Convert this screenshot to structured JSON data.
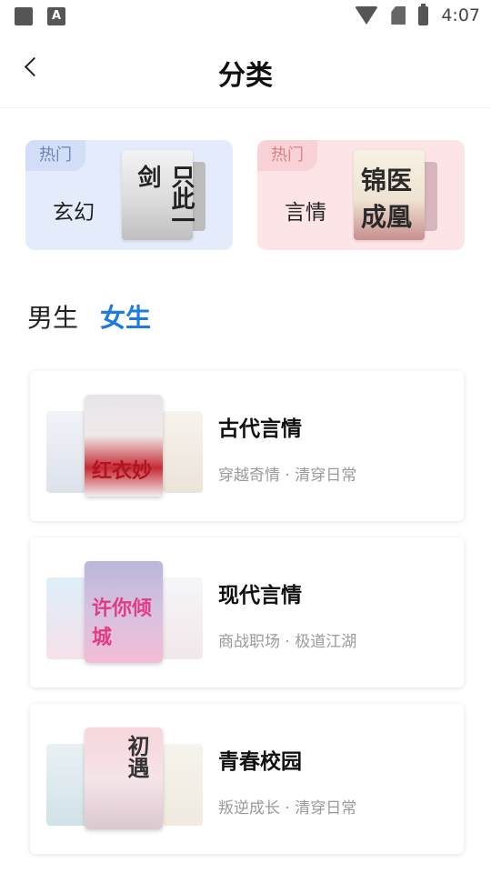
{
  "status_bar": {
    "time": "4:07",
    "icons": [
      "image-icon",
      "a-icon",
      "wifi-icon",
      "no-sim-icon",
      "battery-icon"
    ]
  },
  "header": {
    "title": "分类"
  },
  "hot": [
    {
      "tag": "热门",
      "label": "玄幻",
      "cover_text": "只此一剑"
    },
    {
      "tag": "热门",
      "label": "言情",
      "cover_text": "锦医成凰"
    }
  ],
  "gender_tabs": [
    {
      "label": "男生",
      "active": false
    },
    {
      "label": "女生",
      "active": true
    }
  ],
  "categories": [
    {
      "name": "古代言情",
      "sub": "穿越奇情 · 清穿日常",
      "cover_text": "红衣妙"
    },
    {
      "name": "现代言情",
      "sub": "商战职场 · 极道江湖",
      "cover_text": "许你倾城"
    },
    {
      "name": "青春校园",
      "sub": "叛逆成长 · 清穿日常",
      "cover_text": "初遇"
    }
  ],
  "colors": {
    "accent": "#1e7be0",
    "hot_blue_bg": "#e4ecfb",
    "hot_pink_bg": "#fde5e7"
  }
}
